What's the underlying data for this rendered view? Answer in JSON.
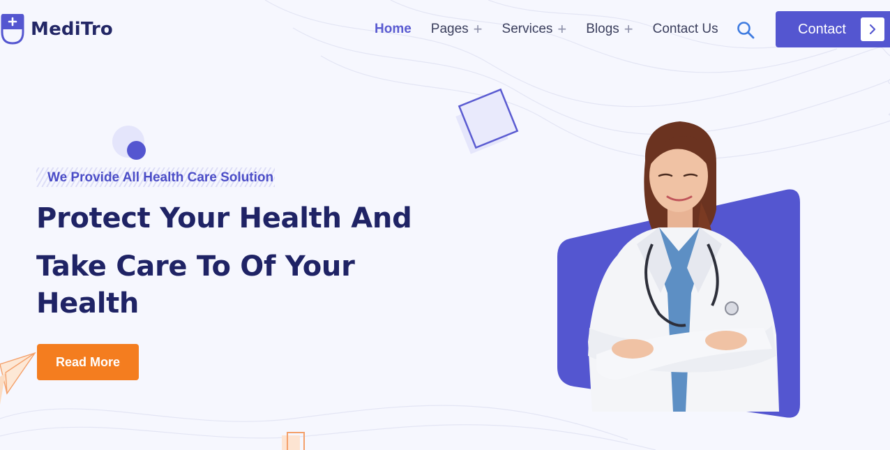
{
  "brand": {
    "name": "MediTro"
  },
  "nav": {
    "items": [
      {
        "label": "Home",
        "has_submenu": false,
        "active": true
      },
      {
        "label": "Pages",
        "has_submenu": true
      },
      {
        "label": "Services",
        "has_submenu": true
      },
      {
        "label": "Blogs",
        "has_submenu": true
      },
      {
        "label": "Contact Us",
        "has_submenu": false
      }
    ],
    "search_icon": "search-icon",
    "contact_button": {
      "label": "Contact",
      "icon": "chevron-right-icon"
    }
  },
  "hero": {
    "eyebrow": "We Provide All Health Care Solution",
    "title_lines": [
      "Protect Your Health And",
      "Take Care To Of Your",
      "Health"
    ],
    "cta_label": "Read More",
    "image": "doctor-portrait"
  },
  "colors": {
    "primary": "#5456d0",
    "heading": "#1f2365",
    "accent": "#f47d1f",
    "background": "#f6f7fe"
  }
}
